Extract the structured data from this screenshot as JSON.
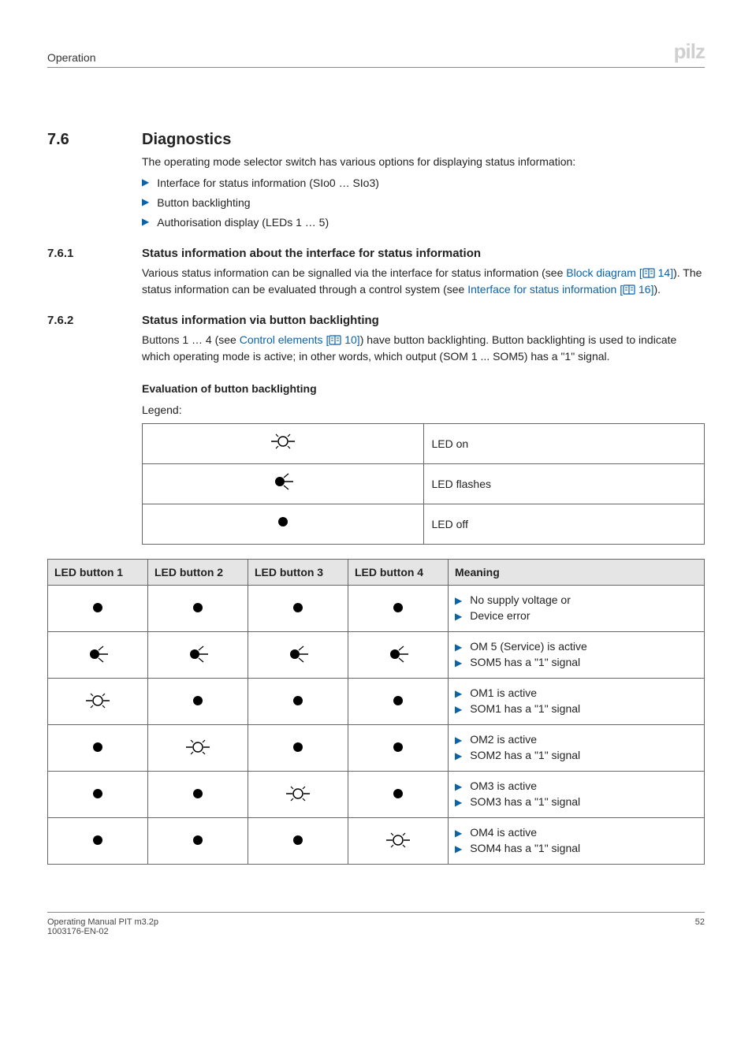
{
  "header": {
    "section": "Operation",
    "logo": "pilz"
  },
  "sec76": {
    "num": "7.6",
    "title": "Diagnostics",
    "intro": "The operating mode selector switch has various options for displaying status information:",
    "bullets": [
      "Interface for status information (SIo0 … SIo3)",
      "Button backlighting",
      "Authorisation display (LEDs 1 … 5)"
    ]
  },
  "sec761": {
    "num": "7.6.1",
    "title": "Status information about the interface for status information",
    "p_a": "Various status information can be signalled via the interface for status information (see ",
    "link1_text": "Block diagram",
    "link1_ref": " 14]",
    "p_b": "). The status information can be evaluated through a control system (see ",
    "link2_text": "Interface for status information",
    "link2_ref": " 16]",
    "p_c": ")."
  },
  "sec762": {
    "num": "7.6.2",
    "title": "Status information via button backlighting",
    "p_a": "Buttons 1 … 4 (see ",
    "link_text": "Control elements",
    "link_ref": " 10]",
    "p_b": ") have button backlighting. Button backlighting is used to indicate which operating mode is active; in other words, which output (SOM 1 ... SOM5) has a \"1\" signal.",
    "eval_heading": "Evaluation of button backlighting",
    "legend_label": "Legend:"
  },
  "legend": {
    "rows": [
      {
        "icon": "on",
        "text": "LED on"
      },
      {
        "icon": "flash",
        "text": "LED flashes"
      },
      {
        "icon": "off",
        "text": "LED off"
      }
    ]
  },
  "table": {
    "headers": [
      "LED button 1",
      "LED button 2",
      "LED button 3",
      "LED button 4",
      "Meaning"
    ],
    "rows": [
      {
        "leds": [
          "off",
          "off",
          "off",
          "off"
        ],
        "meaning": [
          "No supply voltage or",
          "Device error"
        ]
      },
      {
        "leds": [
          "flash",
          "flash",
          "flash",
          "flash"
        ],
        "meaning": [
          "OM 5 (Service) is active",
          "SOM5 has a \"1\" signal"
        ]
      },
      {
        "leds": [
          "on",
          "off",
          "off",
          "off"
        ],
        "meaning": [
          "OM1 is active",
          "SOM1 has a \"1\" signal"
        ]
      },
      {
        "leds": [
          "off",
          "on",
          "off",
          "off"
        ],
        "meaning": [
          "OM2 is active",
          "SOM2 has a \"1\" signal"
        ]
      },
      {
        "leds": [
          "off",
          "off",
          "on",
          "off"
        ],
        "meaning": [
          "OM3 is active",
          "SOM3 has a \"1\" signal"
        ]
      },
      {
        "leds": [
          "off",
          "off",
          "off",
          "on"
        ],
        "meaning": [
          "OM4 is active",
          "SOM4 has a \"1\" signal"
        ]
      }
    ]
  },
  "footer": {
    "line1": "Operating Manual PIT m3.2p",
    "line2": "1003176-EN-02",
    "page": "52"
  }
}
